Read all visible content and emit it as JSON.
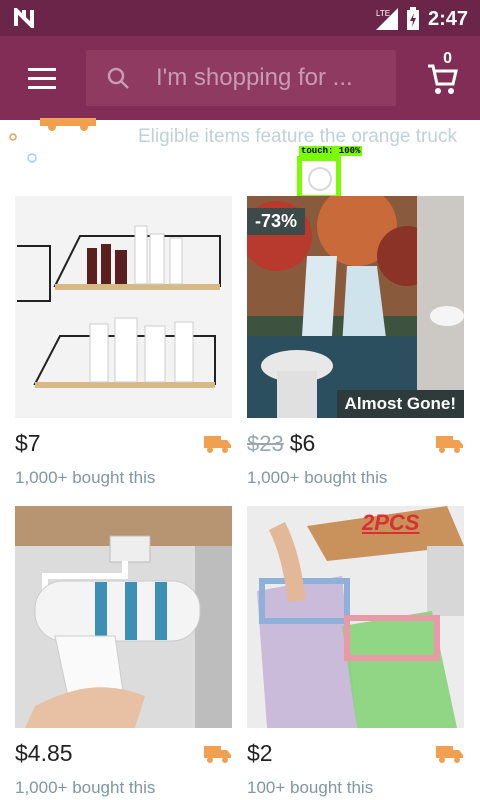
{
  "statusbar": {
    "time": "2:47",
    "network": "LTE"
  },
  "topbar": {
    "search_placeholder": "I'm shopping for ...",
    "cart_count": "0"
  },
  "banner": {
    "text": "Eligible items feature the orange truck"
  },
  "touch": {
    "label": "touch: 100%"
  },
  "products": [
    {
      "price": "$7",
      "old_price": "",
      "bought": "1,000+ bought this"
    },
    {
      "price": "$6",
      "old_price": "$23",
      "bought": "1,000+ bought this",
      "discount": "-73%",
      "tag": "Almost Gone!"
    },
    {
      "price": "$4.85",
      "old_price": "",
      "bought": "1,000+ bought this"
    },
    {
      "price": "$2",
      "old_price": "",
      "bought": "100+ bought this",
      "overlay": "2PCS"
    }
  ],
  "colors": {
    "header": "#822d55",
    "statusbar": "#6b2548",
    "truck": "#f0a050"
  },
  "icons": {
    "menu": "hamburger-icon",
    "search": "search-icon",
    "cart": "cart-icon",
    "shipping": "truck-icon"
  }
}
